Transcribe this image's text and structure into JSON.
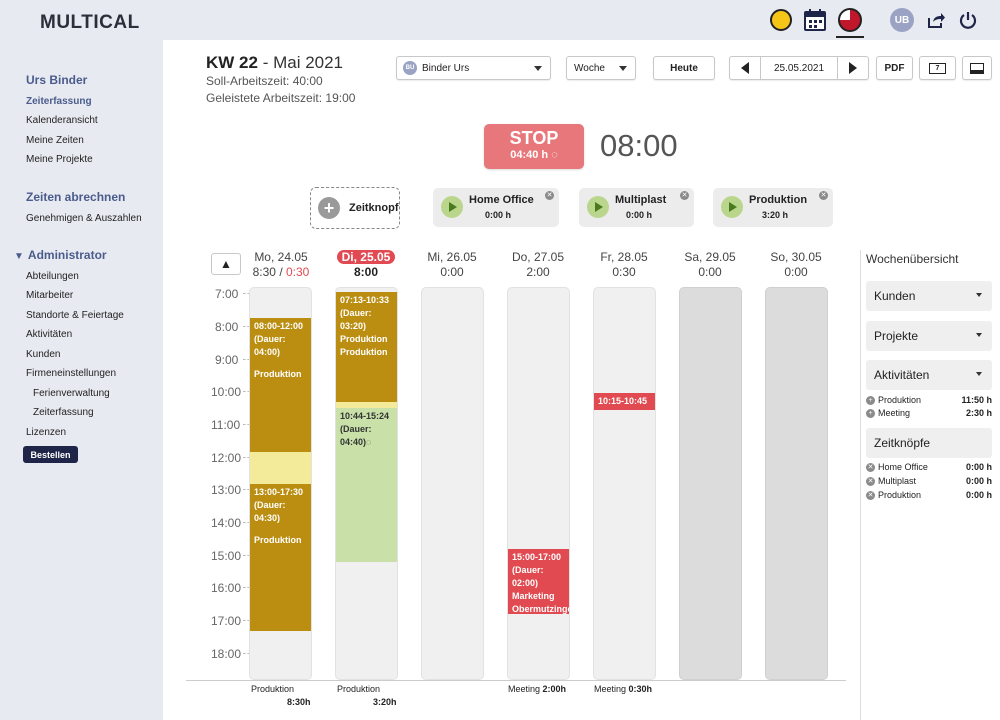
{
  "app": {
    "title": "MULTICAL"
  },
  "topbar": {
    "avatar": "UB",
    "icons": [
      "status-yellow-icon",
      "calendar-icon",
      "clock-pie-icon",
      "share-icon",
      "power-icon"
    ]
  },
  "sidebar": {
    "user": "Urs Binder",
    "links": [
      "Zeiterfassung",
      "Kalenderansicht",
      "Meine Zeiten",
      "Meine Projekte"
    ],
    "section2": "Zeiten abrechnen",
    "section2_links": [
      "Genehmigen & Auszahlen"
    ],
    "section3": "Administrator",
    "admin_links": [
      "Abteilungen",
      "Mitarbeiter",
      "Standorte & Feiertage",
      "Aktivitäten",
      "Kunden",
      "Firmeneinstellungen"
    ],
    "sub_links": [
      "Ferienverwaltung",
      "Zeiterfassung"
    ],
    "extra_link": "Lizenzen",
    "order_button": "Bestellen"
  },
  "header": {
    "kw": "KW 22",
    "month": " - Mai 2021",
    "soll": "Soll-Arbeitszeit: 40:00",
    "geleistet": "Geleistete Arbeitszeit: 19:00"
  },
  "controls": {
    "user_initials": "BU",
    "user_select": "Binder Urs",
    "view_select": "Woche",
    "today": "Heute",
    "date": "25.05.2021",
    "pdf": "PDF",
    "seven": "7"
  },
  "timer": {
    "stop_label": "STOP",
    "stop_sub": "04:40 h",
    "clock": "08:00"
  },
  "timer_buttons": {
    "add_label": "Zeitknopf",
    "items": [
      {
        "name": "Home Office",
        "time": "0:00 h"
      },
      {
        "name": "Multiplast",
        "time": "0:00 h"
      },
      {
        "name": "Produktion",
        "time": "3:20 h"
      }
    ]
  },
  "calendar": {
    "days": [
      {
        "name": "Mo, 24.05",
        "total": "8:30",
        "overtime": "0:30"
      },
      {
        "name": "Di, 25.05",
        "total": "8:00"
      },
      {
        "name": "Mi, 26.05",
        "total": "0:00"
      },
      {
        "name": "Do, 27.05",
        "total": "2:00"
      },
      {
        "name": "Fr, 28.05",
        "total": "0:30"
      },
      {
        "name": "Sa, 29.05",
        "total": "0:00"
      },
      {
        "name": "So, 30.05",
        "total": "0:00"
      }
    ],
    "hours": [
      "7:00",
      "8:00",
      "9:00",
      "10:00",
      "11:00",
      "12:00",
      "13:00",
      "14:00",
      "15:00",
      "16:00",
      "17:00",
      "18:00"
    ],
    "events": {
      "mo_1": {
        "line1": "08:00-12:00",
        "line2": "(Dauer:",
        "line3": "04:00)",
        "line4": "Produktion"
      },
      "mo_2": {
        "line1": "13:00-17:30",
        "line2": "(Dauer:",
        "line3": "04:30)",
        "line4": "Produktion"
      },
      "di_1": {
        "line1": "07:13-10:33",
        "line2": "(Dauer:",
        "line3": "03:20)",
        "line4": "Produktion",
        "line5": "Produktion"
      },
      "di_2": {
        "line1": "10:44-15:24",
        "line2": "(Dauer:",
        "line3": "04:40)"
      },
      "do_1": {
        "line1": "15:00-17:00",
        "line2": "(Dauer:",
        "line3": "02:00)",
        "line4": "Marketing",
        "line5": "Obermutzinger"
      },
      "fr_1": {
        "line1": "10:15-10:45"
      }
    },
    "sums": {
      "mo": {
        "label": "Produktion",
        "value": "8:30h"
      },
      "di": {
        "label": "Produktion",
        "value": "3:20h"
      },
      "do": {
        "label": "Meeting",
        "value": "2:00h"
      },
      "fr": {
        "label": "Meeting",
        "value": "0:30h"
      }
    }
  },
  "overview": {
    "title": "Wochenübersicht",
    "kunden": "Kunden",
    "projekte": "Projekte",
    "aktivitaeten": "Aktivitäten",
    "activity_rows": [
      {
        "label": "Produktion",
        "value": "11:50 h"
      },
      {
        "label": "Meeting",
        "value": "2:30 h"
      }
    ],
    "zeitknoepfe": "Zeitknöpfe",
    "button_rows": [
      {
        "label": "Home Office",
        "value": "0:00 h"
      },
      {
        "label": "Multiplast",
        "value": "0:00 h"
      },
      {
        "label": "Produktion",
        "value": "0:00 h"
      }
    ]
  }
}
